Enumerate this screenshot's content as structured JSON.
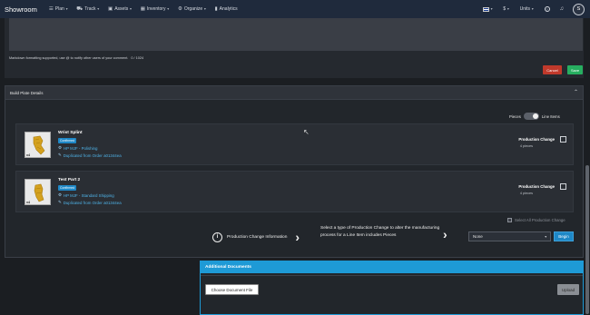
{
  "app": {
    "brand": "Showroom"
  },
  "nav": {
    "items": [
      {
        "label": "Plan",
        "icon": "list-icon"
      },
      {
        "label": "Track",
        "icon": "truck-icon"
      },
      {
        "label": "Assets",
        "icon": "box-icon"
      },
      {
        "label": "Inventory",
        "icon": "boxes-icon"
      },
      {
        "label": "Organize",
        "icon": "gear-icon"
      },
      {
        "label": "Analytics",
        "icon": "bar-chart-icon"
      }
    ],
    "right": {
      "currency": "$",
      "units": "Units",
      "avatar_initial": "S"
    }
  },
  "comment": {
    "help_text": "Markdown formatting supported, use @ to notify other users of your comment.",
    "char_count": "0 / 1024",
    "cancel_label": "Cancel",
    "save_label": "Save"
  },
  "build_plate": {
    "title": "Build Plate Details",
    "toggle": {
      "left_label": "Pieces",
      "right_label": "Line Items",
      "state": "Line Items"
    },
    "items": [
      {
        "name": "Wrist Splint",
        "status": "Confirmed",
        "process": "HP MJF - Polishing",
        "duplicated_from": "Duplicated from Order a01344ea",
        "qty": "x4",
        "pc_label": "Production Change",
        "pc_pieces": "4 pieces"
      },
      {
        "name": "Test Part 2",
        "status": "Confirmed",
        "process": "HP MJF - Standard Shipping",
        "duplicated_from": "Duplicated from Order a01344ea",
        "qty": "x4",
        "pc_label": "Production Change",
        "pc_pieces": "4 pieces"
      }
    ],
    "select_all_label": "Select All Production Change",
    "pci_label": "Production Change Information",
    "pci_description": "Select a type of Production Change to alter the manufacturing process for a Line Item includes Pieces",
    "select_value": "None",
    "begin_label": "Begin"
  },
  "documents": {
    "title": "Additional Documents",
    "choose_label": "Choose Document File",
    "upload_label": "Upload"
  },
  "colors": {
    "navbar": "#1f2a3c",
    "accent": "#1e88c7",
    "cancel": "#c0392b",
    "save": "#27ae60"
  }
}
